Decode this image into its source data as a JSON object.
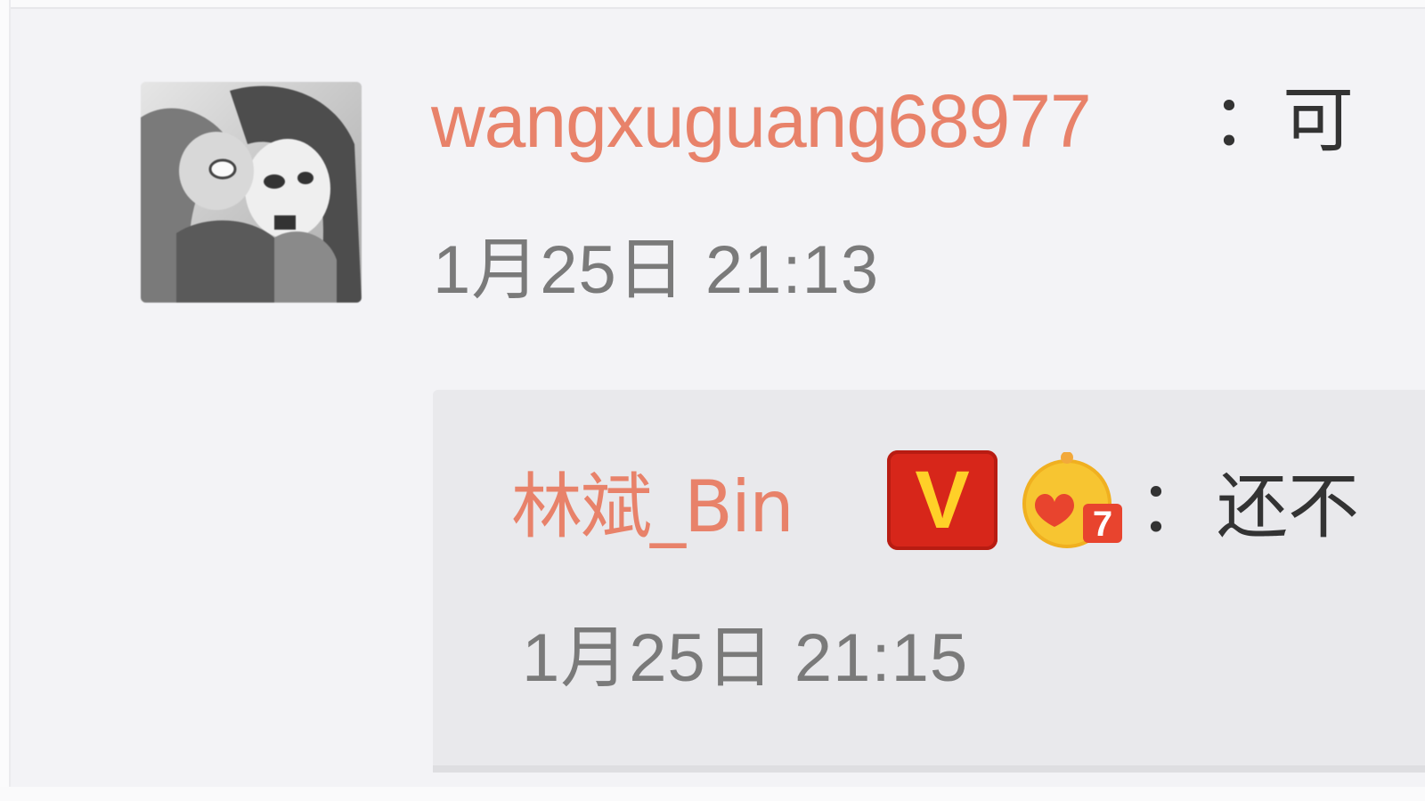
{
  "comment": {
    "author": "wangxuguang68977",
    "separator": "：",
    "text_visible": "可",
    "timestamp": "1月25日 21:13"
  },
  "reply": {
    "author": "林斌_Bin",
    "verified_badge": "V",
    "level_badge_icon": "vip-level-icon",
    "level_badge_number": "7",
    "separator": "：",
    "text_visible": "还不",
    "timestamp": "1月25日 21:15"
  },
  "colors": {
    "background": "#f3f3f6",
    "reply_background": "#e9e9ec",
    "username": "#e8826a",
    "body_text": "#333333",
    "timestamp": "#7a7a7a",
    "verified_badge_bg": "#d7261a",
    "verified_badge_fg": "#ffd028"
  }
}
